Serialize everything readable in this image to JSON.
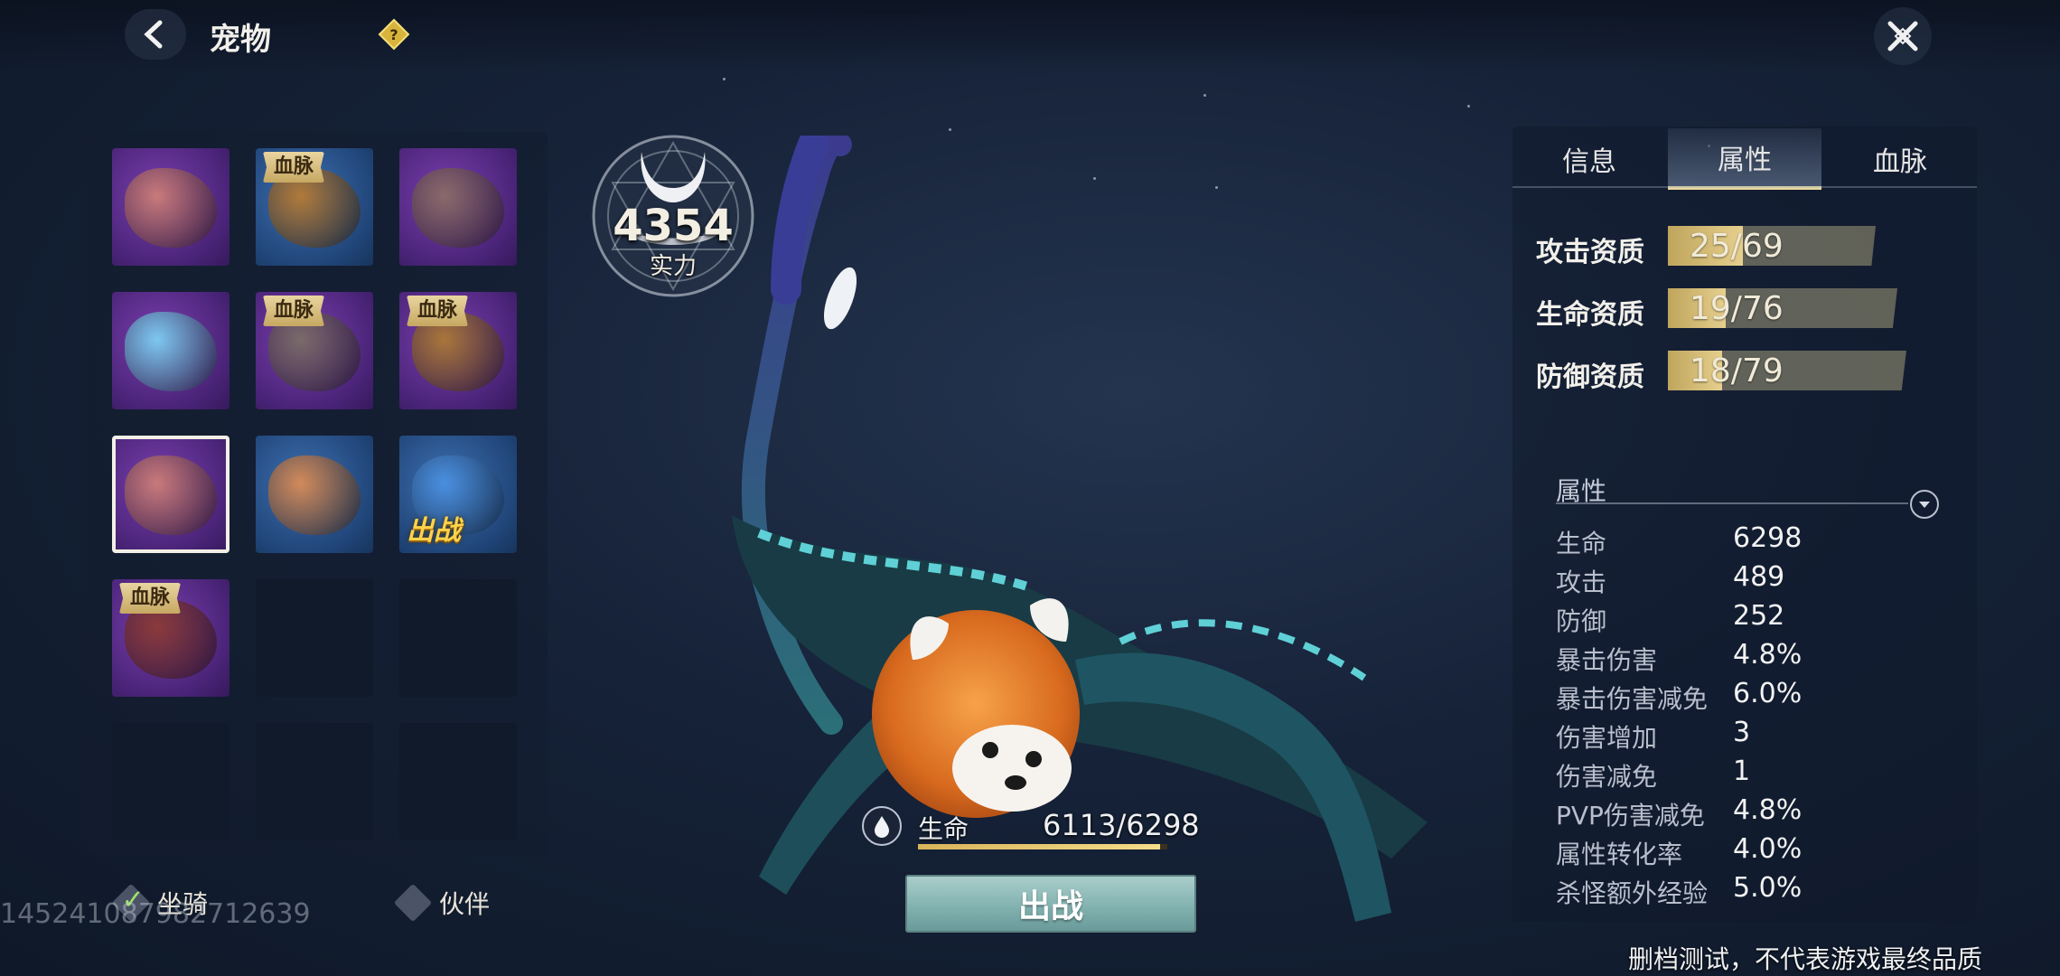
{
  "header": {
    "title": "宠物",
    "back_icon": "chevron-left-icon",
    "help_icon": "diamond-help-icon",
    "close_icon": "close-cross-icon"
  },
  "pet_grid": {
    "slots": [
      {
        "filled": true,
        "theme": "purple",
        "art": "scorpion-pet-art",
        "art_color": "#c87a7a",
        "badge": null
      },
      {
        "filled": true,
        "theme": "blue",
        "art": "lion-beast-pet-art",
        "art_color": "#b07a3a",
        "badge": "血脉"
      },
      {
        "filled": true,
        "theme": "purple",
        "art": "vulture-pet-art",
        "art_color": "#8a6a6a",
        "badge": null
      },
      {
        "filled": true,
        "theme": "purple",
        "art": "ice-dragon-pet-art",
        "art_color": "#7cc8ef",
        "badge": null
      },
      {
        "filled": true,
        "theme": "purple",
        "art": "vulture-pet-art",
        "art_color": "#7a6a6a",
        "badge": "血脉"
      },
      {
        "filled": true,
        "theme": "purple",
        "art": "lion-beast-pet-art",
        "art_color": "#a8763a",
        "badge": "血脉"
      },
      {
        "filled": true,
        "theme": "purple",
        "art": "scorpion-pet-art",
        "art_color": "#c87a7a",
        "badge": null,
        "selected": true
      },
      {
        "filled": true,
        "theme": "blue",
        "art": "shrimp-pet-art",
        "art_color": "#d28a5a",
        "badge": null
      },
      {
        "filled": true,
        "theme": "blue",
        "art": "blue-dragon-pet-art",
        "art_color": "#4a8fe0",
        "badge": null,
        "battle": "出战"
      },
      {
        "filled": true,
        "theme": "purple",
        "art": "armored-beetle-pet-art",
        "art_color": "#8a3a3a",
        "badge": "血脉"
      },
      {
        "filled": false
      },
      {
        "filled": false
      },
      {
        "filled": false
      },
      {
        "filled": false
      },
      {
        "filled": false
      }
    ]
  },
  "filters": {
    "mount_label": "坐骑",
    "mount_checked": true,
    "companion_label": "伙伴",
    "companion_checked": false
  },
  "uid": "1452410879827​12639",
  "power": {
    "value": "4354",
    "label": "实力"
  },
  "hp": {
    "label": "生命",
    "text": "6113/6298",
    "current": 6113,
    "max": 6298
  },
  "battle_button": "出战",
  "tabs": [
    "信息",
    "属性",
    "血脉"
  ],
  "active_tab": 1,
  "aptitudes": [
    {
      "label": "攻击资质",
      "text": "25/69",
      "value": 25,
      "max": 69
    },
    {
      "label": "生命资质",
      "text": "19/76",
      "value": 19,
      "max": 76
    },
    {
      "label": "防御资质",
      "text": "18/79",
      "value": 18,
      "max": 79
    }
  ],
  "attributes": {
    "title": "属性",
    "rows": [
      {
        "name": "生命",
        "value": "6298"
      },
      {
        "name": "攻击",
        "value": "489"
      },
      {
        "name": "防御",
        "value": "252"
      },
      {
        "name": "暴击伤害",
        "value": "4.8%"
      },
      {
        "name": "暴击伤害减免",
        "value": "6.0%"
      },
      {
        "name": "伤害增加",
        "value": "3"
      },
      {
        "name": "伤害减免",
        "value": "1"
      },
      {
        "name": "PVP伤害减免",
        "value": "4.8%"
      },
      {
        "name": "属性转化率",
        "value": "4.0%"
      },
      {
        "name": "杀怪额外经验",
        "value": "5.0%"
      }
    ]
  },
  "disclaimer": "删档测试，不代表游戏最终品质"
}
